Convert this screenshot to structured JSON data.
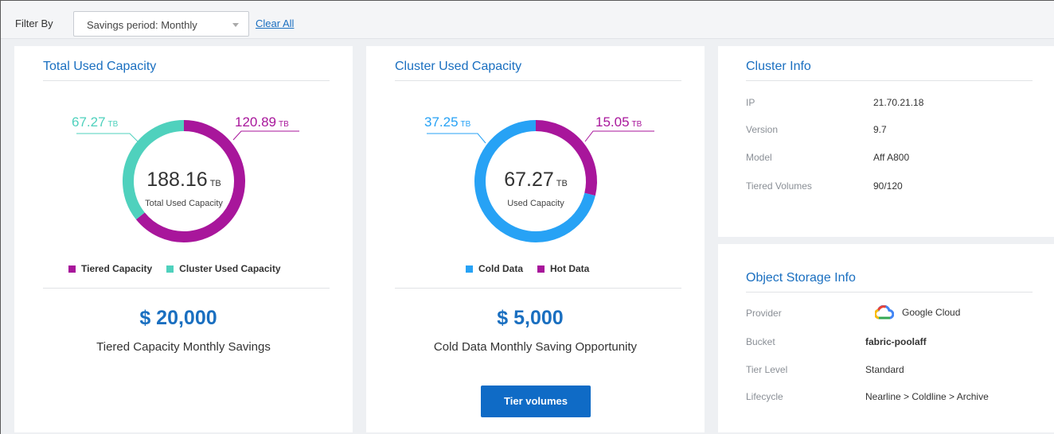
{
  "filter": {
    "label": "Filter By",
    "selected": "Savings period: Monthly",
    "clear_label": "Clear All"
  },
  "total_card": {
    "title": "Total Used Capacity",
    "center_value": "188.16",
    "center_unit": "TB",
    "center_label": "Total Used Capacity",
    "left_value": "67.27",
    "left_unit": "TB",
    "right_value": "120.89",
    "right_unit": "TB",
    "legend": [
      {
        "label": "Tiered Capacity",
        "color": "#a8169b"
      },
      {
        "label": "Cluster Used Capacity",
        "color": "#4fd1bd"
      }
    ],
    "saving_value": "$ 20,000",
    "saving_desc": "Tiered Capacity Monthly Savings"
  },
  "cluster_card": {
    "title": "Cluster Used Capacity",
    "center_value": "67.27",
    "center_unit": "TB",
    "center_label": "Used Capacity",
    "left_value": "37.25",
    "left_unit": "TB",
    "right_value": "15.05",
    "right_unit": "TB",
    "legend": [
      {
        "label": "Cold Data",
        "color": "#27a2f5"
      },
      {
        "label": "Hot Data",
        "color": "#a8169b"
      }
    ],
    "saving_value": "$ 5,000",
    "saving_desc": "Cold Data Monthly Saving Opportunity",
    "button_label": "Tier volumes"
  },
  "cluster_info": {
    "title": "Cluster Info",
    "rows": [
      {
        "key": "IP",
        "value": "21.70.21.18"
      },
      {
        "key": "Version",
        "value": "9.7"
      },
      {
        "key": "Model",
        "value": "Aff A800"
      },
      {
        "key": "Tiered Volumes",
        "value": "90/120"
      }
    ]
  },
  "object_storage": {
    "title": "Object Storage Info",
    "rows": [
      {
        "key": "Provider",
        "value": "Google Cloud",
        "icon": "google-cloud-icon"
      },
      {
        "key": "Bucket",
        "value": "fabric-poolaff"
      },
      {
        "key": "Tier Level",
        "value": "Standard"
      },
      {
        "key": "Lifecycle",
        "value": "Nearline > Coldline > Archive"
      }
    ]
  },
  "chart_data": [
    {
      "type": "pie",
      "categories": [
        "Tiered Capacity",
        "Cluster Used Capacity"
      ],
      "values": [
        120.89,
        67.27
      ],
      "unit": "TB",
      "total": 188.16
    },
    {
      "type": "pie",
      "categories": [
        "Cold Data",
        "Hot Data"
      ],
      "values": [
        37.25,
        15.05
      ],
      "unit": "TB",
      "total": 67.27
    }
  ],
  "colors": {
    "accent": "#1a6fc0",
    "tiered": "#a8169b",
    "cluster_used": "#4fd1bd",
    "cold": "#27a2f5",
    "hot": "#a8169b",
    "button": "#0f6bc6"
  }
}
